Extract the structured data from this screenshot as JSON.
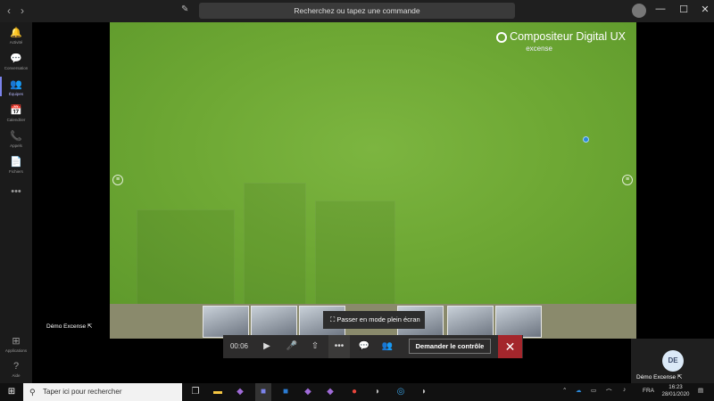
{
  "titlebar": {
    "back": "‹",
    "forward": "›",
    "search_placeholder": "Recherchez ou tapez une commande",
    "minimize": "—",
    "maximize": "☐",
    "close": "✕"
  },
  "rail": [
    {
      "icon": "bell-icon",
      "glyph": "🔔",
      "label": "Activité"
    },
    {
      "icon": "chat-icon",
      "glyph": "💬",
      "label": "Conversation"
    },
    {
      "icon": "teams-icon",
      "glyph": "👥",
      "label": "Équipes",
      "active": true
    },
    {
      "icon": "calendar-icon",
      "glyph": "📅",
      "label": "Calendrier"
    },
    {
      "icon": "phone-icon",
      "glyph": "📞",
      "label": "Appels"
    },
    {
      "icon": "files-icon",
      "glyph": "📄",
      "label": "Fichiers"
    },
    {
      "icon": "more-icon",
      "glyph": "•••",
      "label": ""
    }
  ],
  "rail_bottom": [
    {
      "icon": "apps-icon",
      "glyph": "⊞",
      "label": "Applications"
    },
    {
      "icon": "help-icon",
      "glyph": "?",
      "label": "Aide"
    }
  ],
  "share": {
    "logo_title": "Compositeur Digital UX",
    "logo_sub": "excense"
  },
  "tooltip": "Passer en mode plein écran",
  "callbar": {
    "timer": "00:06",
    "take_control": "Demander le contrôle"
  },
  "participants": {
    "left_name": "Démo Excense",
    "pip_initials": "DE",
    "pip_name": "Démo Excense"
  },
  "taskbar": {
    "search_placeholder": "Taper ici pour rechercher",
    "lang": "FRA",
    "time": "16:23",
    "date": "28/01/2020"
  },
  "colors": {
    "accent": "#7b83eb",
    "hangup": "#a4262c",
    "share_bg": "#6ea834"
  }
}
